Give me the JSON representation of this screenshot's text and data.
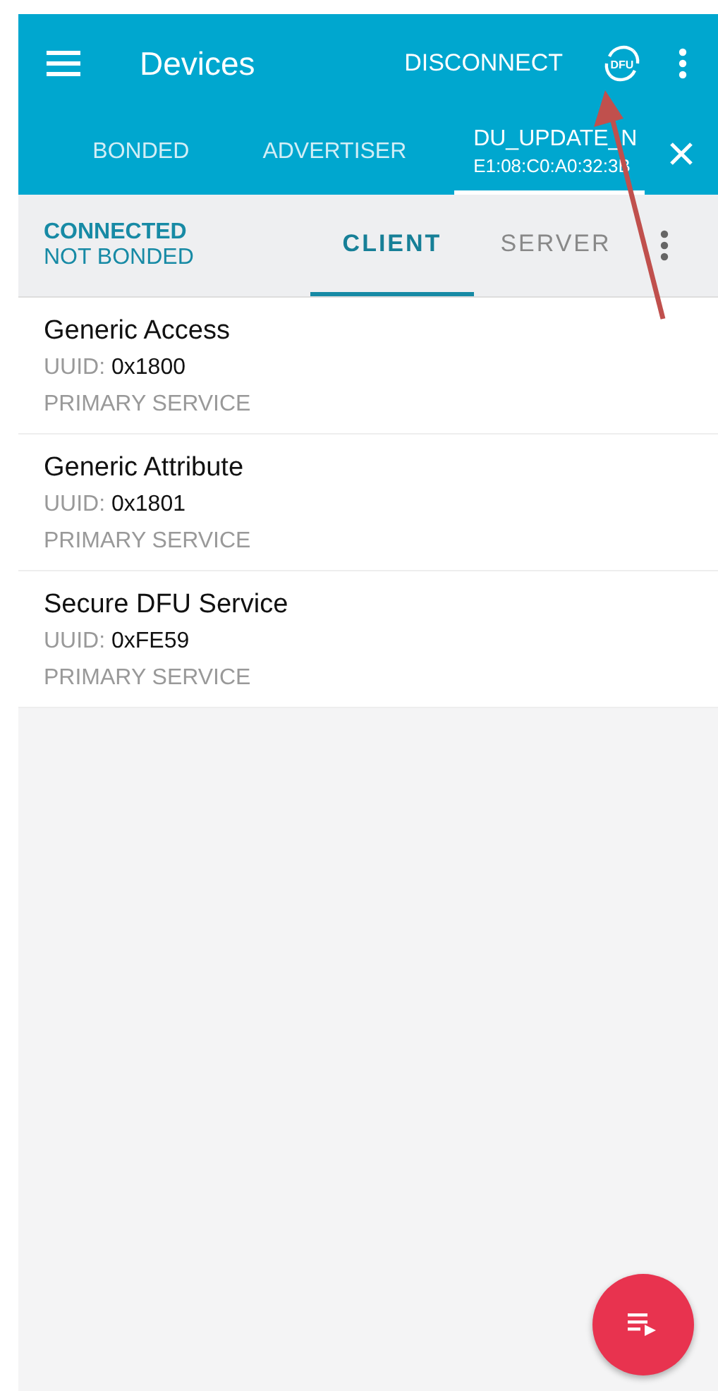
{
  "toolbar": {
    "title": "Devices",
    "action": "DISCONNECT",
    "dfu_label": "DFU"
  },
  "device_tabs": [
    {
      "label": "BONDED",
      "selected": false
    },
    {
      "label": "ADVERTISER",
      "selected": false
    },
    {
      "label": "DU_UPDATE_N",
      "address": "E1:08:C0:A0:32:3B",
      "selected": true
    }
  ],
  "connection": {
    "state": "CONNECTED",
    "bond": "NOT BONDED"
  },
  "sub_tabs": [
    {
      "label": "CLIENT",
      "selected": true
    },
    {
      "label": "SERVER",
      "selected": false
    }
  ],
  "services": [
    {
      "name": "Generic Access",
      "uuid_label": "UUID:",
      "uuid": "0x1800",
      "type": "PRIMARY SERVICE"
    },
    {
      "name": "Generic Attribute",
      "uuid_label": "UUID:",
      "uuid": "0x1801",
      "type": "PRIMARY SERVICE"
    },
    {
      "name": "Secure DFU Service",
      "uuid_label": "UUID:",
      "uuid": "0xFE59",
      "type": "PRIMARY SERVICE"
    }
  ]
}
